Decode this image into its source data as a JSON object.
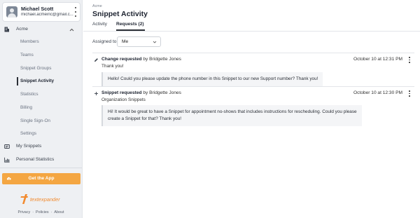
{
  "user": {
    "name": "Michael Scott",
    "email": "michael.acmeinc@gmail.c..."
  },
  "sidebar": {
    "org": "Acme",
    "items": [
      {
        "label": "Members"
      },
      {
        "label": "Teams"
      },
      {
        "label": "Snippet Groups"
      },
      {
        "label": "Snippet Activity"
      },
      {
        "label": "Statistics"
      },
      {
        "label": "Billing"
      },
      {
        "label": "Single Sign-On"
      },
      {
        "label": "Settings"
      }
    ],
    "my_snippets": "My Snippets",
    "personal_statistics": "Personal Statistics",
    "get_app": "Get the App",
    "logo_text": "textexpander",
    "footer": [
      "Privacy",
      "Policies",
      "About"
    ]
  },
  "main": {
    "breadcrumb": "Acme",
    "title": "Snippet Activity",
    "tabs": [
      {
        "label": "Activity"
      },
      {
        "label": "Requests (2)"
      }
    ],
    "filter": {
      "label": "Assigned to",
      "value": "Me"
    },
    "requests": [
      {
        "title": "Change requested",
        "by": " by Bridgette Jones",
        "note": "Thank you!",
        "time": "October 10 at 12:31 PM",
        "message": "Hello! Could you please update the phone number in this Snippet to our new Support number? Thank you!"
      },
      {
        "title": "Snippet requested",
        "by": " by Bridgette Jones",
        "note": "Organization Snippets",
        "time": "October 10 at 12:30 PM",
        "message_line1": "Hi! It would be great to have a Snippet for appointment no-shows that includes instructions for rescheduling. Could you please",
        "message_line2": "create a Snippet for that? Thank you!"
      }
    ]
  },
  "colors": {
    "accent": "#f4a642",
    "logo": "#f28a2e",
    "sidebar_bg": "#eef0f3"
  },
  "icons": [
    "kebab-icon",
    "building-icon",
    "chevron-up-icon",
    "snippets-icon",
    "chart-icon",
    "cloud-download-icon",
    "pencil-icon",
    "plus-icon",
    "chevron-down-icon"
  ]
}
